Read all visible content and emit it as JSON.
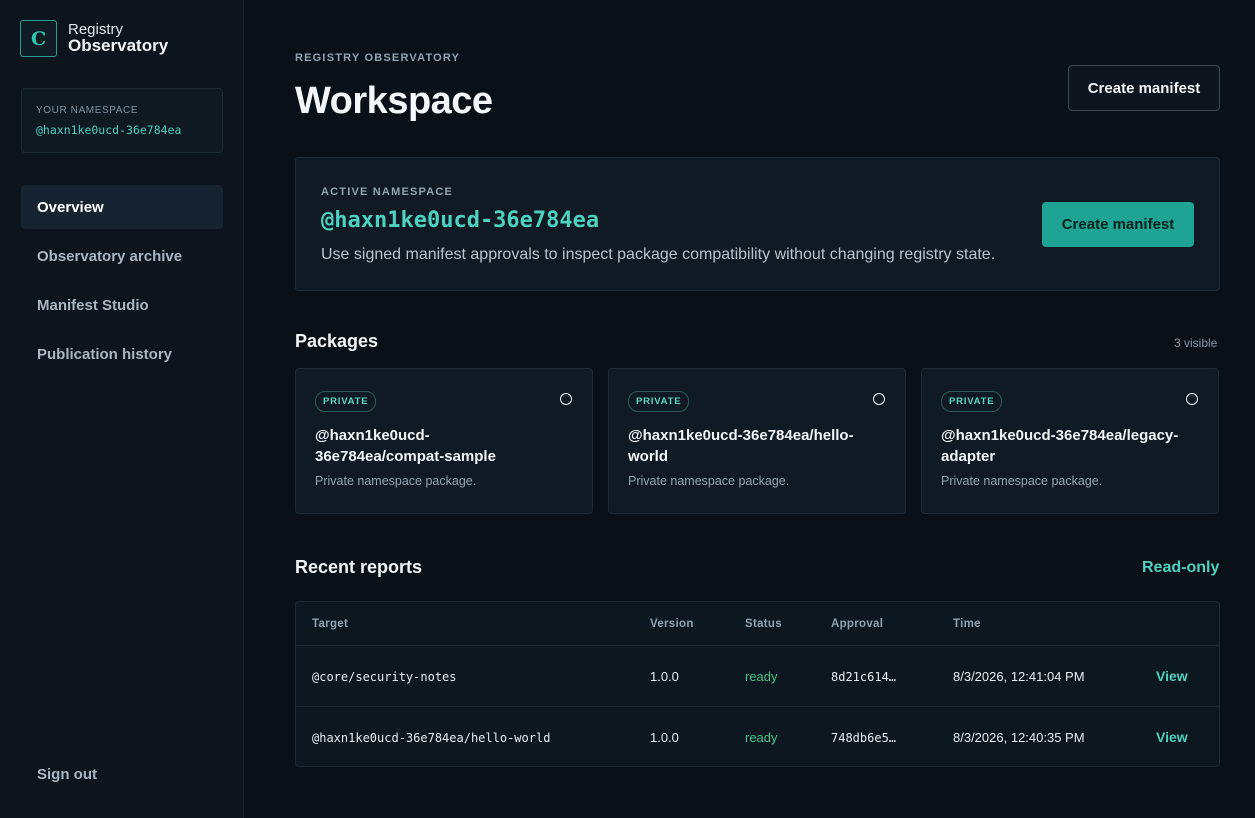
{
  "brand": {
    "logo_letter": "C",
    "line1": "Registry",
    "line2": "Observatory"
  },
  "sidebar": {
    "namespace_label": "YOUR NAMESPACE",
    "namespace_value": "@haxn1ke0ucd-36e784ea",
    "items": [
      {
        "label": "Overview",
        "active": true
      },
      {
        "label": "Observatory archive",
        "active": false
      },
      {
        "label": "Manifest Studio",
        "active": false
      },
      {
        "label": "Publication history",
        "active": false
      }
    ],
    "sign_out": "Sign out"
  },
  "header": {
    "eyebrow": "REGISTRY OBSERVATORY",
    "title": "Workspace",
    "create_button": "Create manifest"
  },
  "hero": {
    "label": "ACTIVE NAMESPACE",
    "namespace": "@haxn1ke0ucd-36e784ea",
    "description": "Use signed manifest approvals to inspect package compatibility without changing registry state.",
    "button": "Create manifest"
  },
  "packages": {
    "title": "Packages",
    "count": "3 visible",
    "items": [
      {
        "badge": "PRIVATE",
        "name_line1": "@haxn1ke0ucd-",
        "name_line2": "36e784ea/compat-sample",
        "description": "Private namespace package."
      },
      {
        "badge": "PRIVATE",
        "name_line1": "@haxn1ke0ucd-36e784ea/hello-",
        "name_line2": "world",
        "description": "Private namespace package."
      },
      {
        "badge": "PRIVATE",
        "name_line1": "@haxn1ke0ucd-36e784ea/legacy-",
        "name_line2": "adapter",
        "description": "Private namespace package."
      }
    ]
  },
  "reports": {
    "title": "Recent reports",
    "mode": "Read-only",
    "columns": {
      "target": "Target",
      "version": "Version",
      "status": "Status",
      "approval": "Approval",
      "time": "Time"
    },
    "rows": [
      {
        "target": "@core/security-notes",
        "version": "1.0.0",
        "status": "ready",
        "approval": "8d21c614…",
        "time": "8/3/2026, 12:41:04 PM",
        "action": "View"
      },
      {
        "target": "@haxn1ke0ucd-36e784ea/hello-world",
        "version": "1.0.0",
        "status": "ready",
        "approval": "748db6e5…",
        "time": "8/3/2026, 12:40:35 PM",
        "action": "View"
      }
    ]
  },
  "colors": {
    "accent": "#1fa394",
    "accent_text": "#4fd1c0",
    "status_ready": "#4cc38a",
    "background": "#0a1018"
  }
}
